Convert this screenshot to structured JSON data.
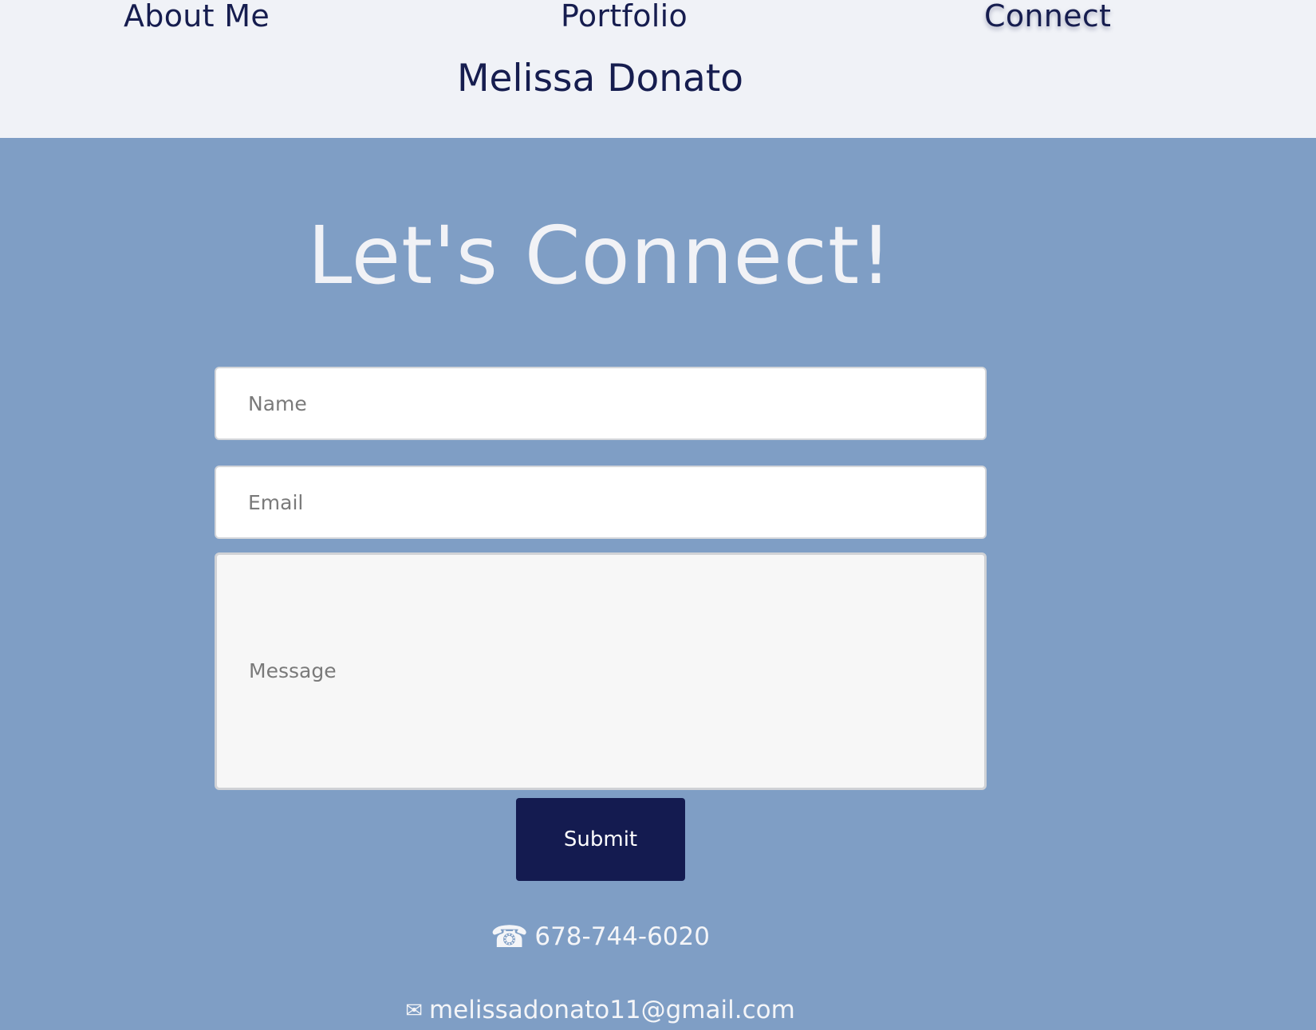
{
  "nav": {
    "about_label": "About Me",
    "portfolio_label": "Portfolio",
    "connect_label": "Connect"
  },
  "site_title": "Melissa Donato",
  "contact": {
    "heading": "Let's Connect!",
    "form": {
      "name_placeholder": "Name",
      "email_placeholder": "Email",
      "message_placeholder": "Message",
      "submit_label": "Submit"
    },
    "phone": "678-744-6020",
    "email": "melissadonato11@gmail.com",
    "phone_icon": "telephone-icon",
    "email_icon": "envelope-icon"
  },
  "colors": {
    "header_bg": "#f0f2f7",
    "main_bg": "#7f9ec5",
    "navy": "#161d4f",
    "button_bg": "#141b50"
  }
}
